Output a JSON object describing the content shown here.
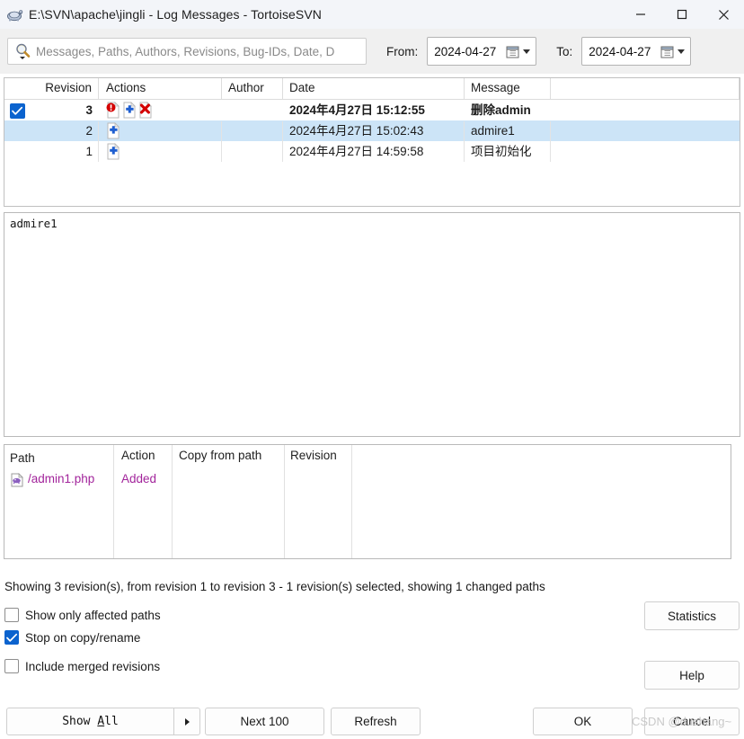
{
  "window": {
    "title": "E:\\SVN\\apache\\jingli - Log Messages - TortoiseSVN",
    "icon": "tortoisesvn-icon",
    "minimize_label": "—",
    "maximize_label": "□",
    "close_label": "✕"
  },
  "toolbar": {
    "search": {
      "placeholder": "Messages, Paths, Authors, Revisions, Bug-IDs, Date, D",
      "value": "",
      "icon": "search-icon"
    },
    "from": {
      "label": "From:",
      "value": "2024-04-27"
    },
    "to": {
      "label": "To:",
      "value": "2024-04-27"
    }
  },
  "log_list": {
    "columns": [
      "Revision",
      "Actions",
      "Author",
      "Date",
      "Message"
    ],
    "rows": [
      {
        "checked": false,
        "selected": false,
        "bold": true,
        "revision": "3",
        "actions": [
          "modified-icon",
          "added-icon",
          "deleted-icon"
        ],
        "author": "",
        "date": "2024年4月27日 15:12:55",
        "message": "删除admin"
      },
      {
        "checked": true,
        "selected": true,
        "bold": false,
        "revision": "2",
        "actions": [
          "added-icon"
        ],
        "author": "",
        "date": "2024年4月27日 15:02:43",
        "message": "admire1"
      },
      {
        "checked": false,
        "selected": false,
        "bold": false,
        "revision": "1",
        "actions": [
          "added-icon"
        ],
        "author": "",
        "date": "2024年4月27日 14:59:58",
        "message": "项目初始化"
      }
    ]
  },
  "message_pane": {
    "text": "admire1"
  },
  "paths": {
    "columns": [
      "Path",
      "Action",
      "Copy from path",
      "Revision"
    ],
    "rows": [
      {
        "icon": "php-file-icon",
        "path": "/admin1.php",
        "action": "Added",
        "copy_from_path": "",
        "revision": ""
      }
    ]
  },
  "status": {
    "text": "Showing 3 revision(s), from revision 1 to revision 3 - 1 revision(s) selected, showing 1 changed paths"
  },
  "options": [
    {
      "label": "Show only affected paths",
      "checked": false
    },
    {
      "label": "Stop on copy/rename",
      "checked": true
    },
    {
      "label": "Include merged revisions",
      "checked": false
    }
  ],
  "buttons": {
    "show_all_prefix": "Show ",
    "show_all_accel": "A",
    "show_all_suffix": "ll",
    "next_100": "Next 100",
    "refresh": "Refresh",
    "statistics": "Statistics",
    "help": "Help",
    "ok": "OK",
    "cancel": "Cancel"
  },
  "watermark": {
    "text": "CSDN @dushang~"
  },
  "colors": {
    "accent": "#0b63ce",
    "selection": "#cce4f7",
    "path_text": "#a2249b",
    "titlebar": "#f3f5f9",
    "dialog_bg": "#f0f0f0"
  }
}
